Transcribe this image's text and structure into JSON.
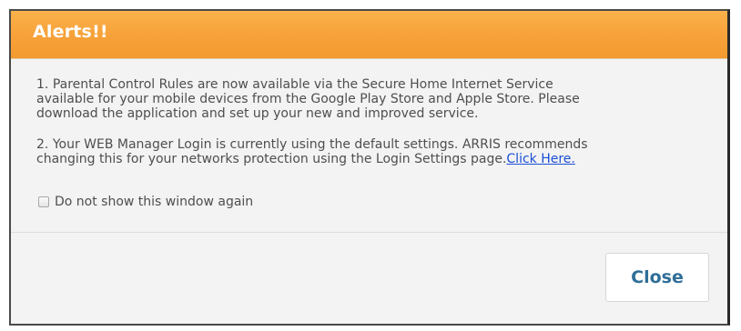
{
  "dialog": {
    "title": "Alerts!!",
    "alerts": [
      {
        "number": "1.",
        "lines": [
          "Parental Control Rules are now available via the Secure Home Internet Service",
          "available for your mobile devices from the Google Play Store and Apple Store. Please",
          "download the application and set up your new and improved service."
        ]
      },
      {
        "number": "2.",
        "lines": [
          "Your WEB Manager Login is currently using the default settings. ARRIS recommends",
          "changing this for your networks protection using the Login Settings page."
        ],
        "link_text": "Click Here."
      }
    ],
    "checkbox": {
      "label": "Do not show this window again",
      "checked": false
    },
    "close_label": "Close"
  },
  "colors": {
    "header": "#f7a23a",
    "header_text": "#ffffff",
    "body_text": "#4e4e4e",
    "link": "#1a4fd6",
    "close_text": "#2f6e97"
  }
}
